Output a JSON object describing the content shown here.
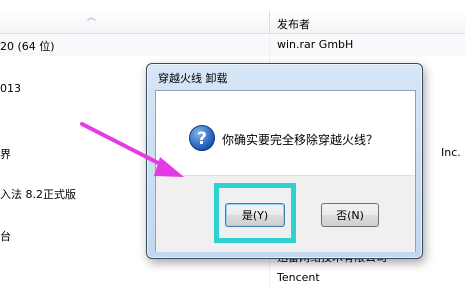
{
  "list": {
    "header_publisher": "发布者",
    "rows": [
      {
        "name": "20 (64 位)",
        "publisher": "win.rar GmbH"
      },
      {
        "name": "013",
        "publisher": ""
      },
      {
        "name": "界",
        "publisher": "Inc."
      },
      {
        "name": "入法 8.2正式版",
        "publisher": ""
      },
      {
        "name": "台",
        "publisher": "迅雷网络技术有限公司"
      },
      {
        "name": "",
        "publisher": "Tencent"
      }
    ]
  },
  "dialog": {
    "title": "穿越火线  卸载",
    "message": "你确实要完全移除穿越火线？",
    "icon": "question-icon",
    "yes_label": "是(Y)",
    "no_label": "否(N)"
  },
  "colors": {
    "arrow": "#e53ae8",
    "highlight": "#2fd0d0"
  }
}
